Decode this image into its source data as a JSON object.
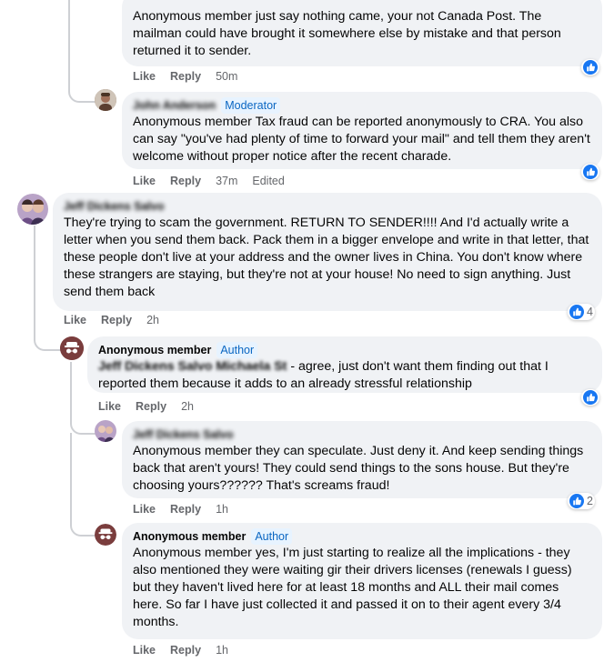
{
  "comments": [
    {
      "text": "Anonymous member just say nothing came, your not Canada Post. The mailman could have brought it somewhere else by mistake and that person returned it to sender.",
      "actions": {
        "like": "Like",
        "reply": "Reply",
        "time": "50m"
      }
    },
    {
      "author": "John Anderson",
      "badge": "Moderator",
      "text": "Anonymous member Tax fraud can be reported anonymously to CRA. You also can say \"you've had plenty of time to forward your mail\" and tell them they aren't welcome without proper notice after the recent charade.",
      "actions": {
        "like": "Like",
        "reply": "Reply",
        "time": "37m",
        "edited": "Edited"
      }
    },
    {
      "author": "Jeff Dickens Salvo",
      "text": "They're trying to scam the government. RETURN TO SENDER!!!! And I'd actually write a letter when you send them back. Pack them in a bigger envelope and write in that letter, that these people don't live at your address and the owner lives in China. You don't know where these strangers are staying, but they're not at your house! No need to sign anything. Just send them back",
      "actions": {
        "like": "Like",
        "reply": "Reply",
        "time": "2h"
      },
      "reaction_count": "4"
    },
    {
      "author": "Anonymous member",
      "badge": "Author",
      "tag": "Jeff Dickens Salvo Michaela St",
      "text": " - agree, just don't want them finding out that I reported them because it adds to an already stressful relationship",
      "actions": {
        "like": "Like",
        "reply": "Reply",
        "time": "2h"
      }
    },
    {
      "author": "Jeff Dickens Salvo",
      "text": "Anonymous member they can speculate. Just deny it. And keep sending things back that aren't yours! They could send things to the sons house. But they're choosing yours?????? That's screams fraud!",
      "actions": {
        "like": "Like",
        "reply": "Reply",
        "time": "1h"
      },
      "reaction_count": "2"
    },
    {
      "author": "Anonymous member",
      "badge": "Author",
      "text": "Anonymous member yes, I'm just starting to realize all the implications - they also mentioned they were waiting gir their drivers licenses (renewals I guess) but they haven't lived here for at least 18 months and ALL their mail comes here. So far I have just collected it and passed it on to their agent every 3/4 months.",
      "actions": {
        "like": "Like",
        "reply": "Reply",
        "time": "1h"
      }
    }
  ],
  "colors": {
    "bubble": "#f0f2f5",
    "like_blue": "#1877f2",
    "meta": "#65676b",
    "badge": "#0a66c2"
  },
  "icons": {
    "reaction": "like-icon",
    "anonymous": "anonymous-avatar-icon"
  }
}
